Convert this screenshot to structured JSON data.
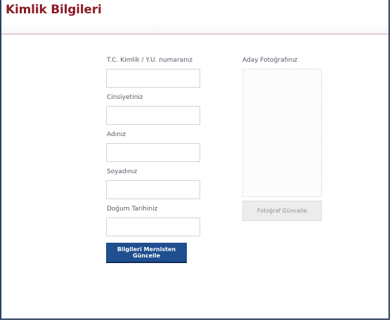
{
  "header": {
    "title": "Kimlik Bilgileri"
  },
  "form": {
    "tc_label": "T.C. Kimlik / Y.U. numaranız",
    "tc_value": "",
    "gender_label": "Cinsiyetiniz",
    "gender_value": "",
    "name_label": "Adınız",
    "name_value": "",
    "surname_label": "Soyadınız",
    "surname_value": "",
    "birthdate_label": "Doğum Tarihiniz",
    "birthdate_value": "",
    "update_button_label": "Bilgileri Mernisten Güncelle"
  },
  "photo": {
    "label": "Aday Fotoğrafınız",
    "button_label": "Fotoğraf Güncelle"
  },
  "colors": {
    "title": "#8b1c24",
    "primary_button": "#1f4f8f",
    "frame_border": "#2b3f63"
  }
}
